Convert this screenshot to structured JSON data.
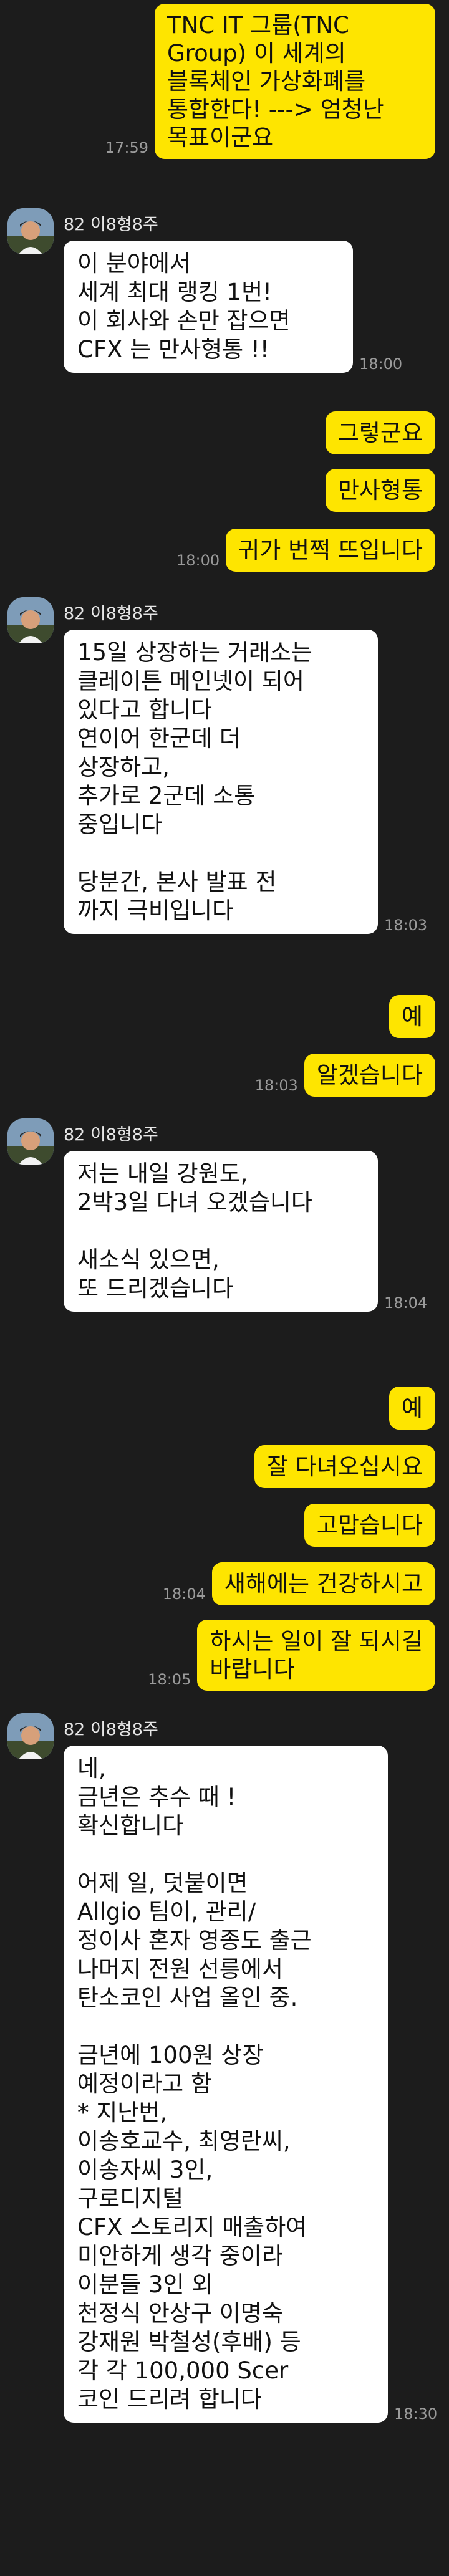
{
  "colors": {
    "background": "#1c1c1c",
    "outgoing_bubble": "#fee500",
    "incoming_bubble": "#ffffff",
    "timestamp": "#9a9a9a"
  },
  "sender_name": "82 이8형8주",
  "messages": [
    {
      "id": "m1",
      "direction": "out",
      "text": "TNC IT 그룹(TNC\nGroup) 이 세계의\n블록체인 가상화폐를\n통합한다! ---> 엄청난\n목표이군요",
      "time": "17:59"
    },
    {
      "id": "m2",
      "direction": "in",
      "text": "이 분야에서\n세계 최대 랭킹 1번!\n이 회사와 손만 잡으면\nCFX 는 만사형통 !!",
      "time": "18:00"
    },
    {
      "id": "m3",
      "direction": "out",
      "text": "그렇군요",
      "time": ""
    },
    {
      "id": "m4",
      "direction": "out",
      "text": "만사형통",
      "time": ""
    },
    {
      "id": "m5",
      "direction": "out",
      "text": "귀가 번쩍 뜨입니다",
      "time": "18:00"
    },
    {
      "id": "m6",
      "direction": "in",
      "text": "15일 상장하는 거래소는\n클레이튼 메인넷이 되어\n있다고 합니다\n연이어 한군데 더\n상장하고,\n추가로 2군데 소통\n중입니다\n\n당분간, 본사 발표 전\n까지 극비입니다",
      "time": "18:03"
    },
    {
      "id": "m7",
      "direction": "out",
      "text": "예",
      "time": ""
    },
    {
      "id": "m8",
      "direction": "out",
      "text": "알겠습니다",
      "time": "18:03"
    },
    {
      "id": "m9",
      "direction": "in",
      "text": "저는 내일 강원도,\n2박3일 다녀 오겠습니다\n\n새소식 있으면,\n또 드리겠습니다",
      "time": "18:04"
    },
    {
      "id": "m10",
      "direction": "out",
      "text": "예",
      "time": ""
    },
    {
      "id": "m11",
      "direction": "out",
      "text": "잘 다녀오십시요",
      "time": ""
    },
    {
      "id": "m12",
      "direction": "out",
      "text": "고맙습니다",
      "time": ""
    },
    {
      "id": "m13",
      "direction": "out",
      "text": "새해에는 건강하시고",
      "time": "18:04"
    },
    {
      "id": "m14",
      "direction": "out",
      "text": "하시는 일이 잘 되시길\n바랍니다",
      "time": "18:05"
    },
    {
      "id": "m15",
      "direction": "in",
      "text": "네,\n금년은 추수 때 !\n확신합니다\n\n어제 일, 덧붙이면\nAllgio 팀이, 관리/\n정이사 혼자 영종도 출근\n나머지 전원 선릉에서\n탄소코인 사업 올인 중.\n\n금년에 100원 상장\n예정이라고 함\n* 지난번,\n이송호교수, 최영란씨,\n이송자씨 3인,\n구로디지털\nCFX 스토리지 매출하여\n미안하게 생각 중이라\n이분들 3인 외\n천정식 안상구 이명숙\n강재원 박철성(후배) 등\n각 각 100,000 Scer\n코인 드리려 합니다",
      "time": "18:30"
    }
  ]
}
